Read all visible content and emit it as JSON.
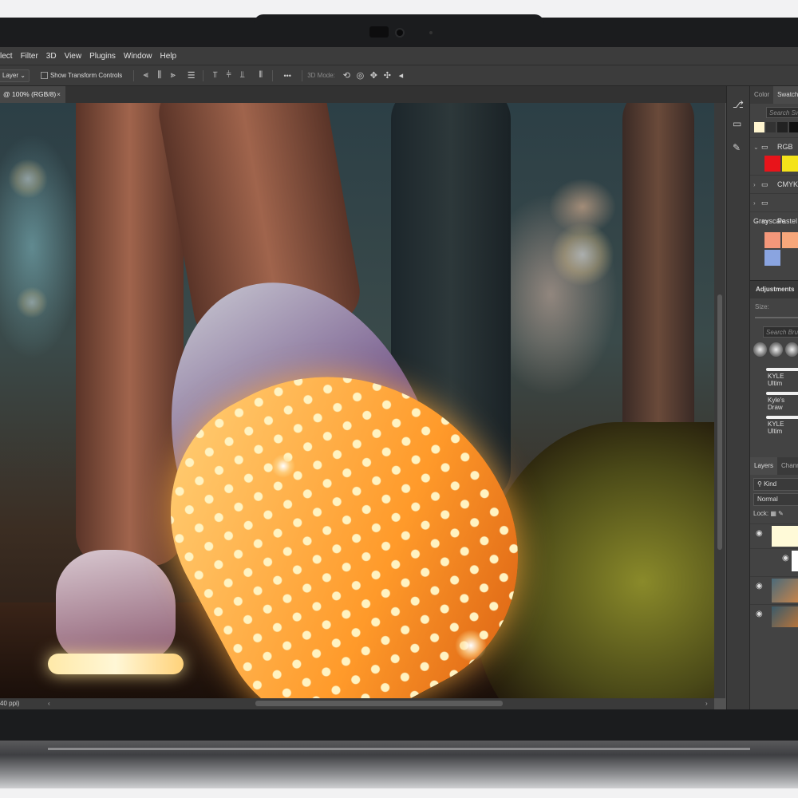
{
  "menu": [
    "lect",
    "Filter",
    "3D",
    "View",
    "Plugins",
    "Window",
    "Help"
  ],
  "options": {
    "layer_select": "Layer",
    "show_transform": "Show Transform Controls",
    "mode_label": "3D Mode:",
    "more": "•••"
  },
  "document": {
    "tab_label": "@ 100% (RGB/8)",
    "close": "×",
    "status": "40 ppi)"
  },
  "panel": {
    "tabs": [
      "Color",
      "Swatches"
    ],
    "search_swatches": "Search Sw",
    "folders": [
      "RGB",
      "CMYK",
      "Grayscale",
      "Pastel"
    ],
    "adjustments": "Adjustments",
    "size_label": "Size:",
    "search_brushes": "Search Brus",
    "brushes": [
      "KYLE Ultim",
      "Kyle's Draw",
      "KYLE Ultim"
    ],
    "layers_tabs": [
      "Layers",
      "Channels"
    ],
    "kind": "Kind",
    "blend_mode": "Normal",
    "lock_label": "Lock:"
  },
  "colors": {
    "screen_bg": "#535353",
    "toolbar": "#3c3c3c",
    "swatch_red": "#e8141a",
    "swatch_yellow": "#f4e31a",
    "pastel_1": "#f4977a",
    "pastel_2": "#f7a77b",
    "pastel_3": "#7fb9e8",
    "pastel_4": "#8aa4e0"
  }
}
